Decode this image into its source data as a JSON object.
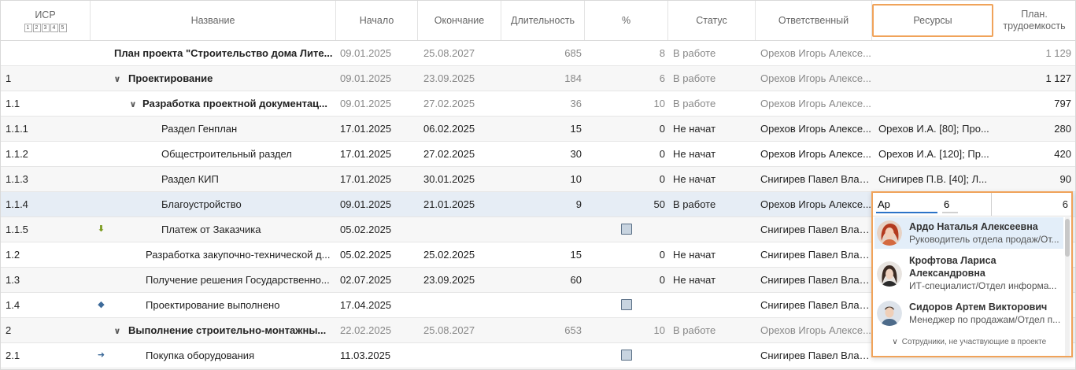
{
  "header": {
    "wbs": "ИСР",
    "levels": [
      "1",
      "2",
      "3",
      "4",
      "5"
    ],
    "name": "Название",
    "start": "Начало",
    "end": "Окончание",
    "duration": "Длительность",
    "percent": "%",
    "status": "Статус",
    "owner": "Ответственный",
    "resources": "Ресурсы",
    "labor": "План. трудоемкость"
  },
  "rows": [
    {
      "wbs": "",
      "name": "План проекта \"Строительство дома Лите...",
      "start": "09.01.2025",
      "end": "25.08.2027",
      "duration": "685",
      "percent": "8",
      "status": "В работе",
      "owner": "Орехов Игорь Алексе...",
      "resources": "",
      "labor": "1 129"
    },
    {
      "wbs": "1",
      "name": "Проектирование",
      "start": "09.01.2025",
      "end": "23.09.2025",
      "duration": "184",
      "percent": "6",
      "status": "В работе",
      "owner": "Орехов Игорь Алексе...",
      "resources": "",
      "labor": "1 127"
    },
    {
      "wbs": "1.1",
      "name": "Разработка проектной документац...",
      "start": "09.01.2025",
      "end": "27.02.2025",
      "duration": "36",
      "percent": "10",
      "status": "В работе",
      "owner": "Орехов Игорь Алексе...",
      "resources": "",
      "labor": "797"
    },
    {
      "wbs": "1.1.1",
      "name": "Раздел Генплан",
      "start": "17.01.2025",
      "end": "06.02.2025",
      "duration": "15",
      "percent": "0",
      "status": "Не начат",
      "owner": "Орехов Игорь Алексе...",
      "resources": "Орехов И.А. [80]; Про...",
      "labor": "280"
    },
    {
      "wbs": "1.1.2",
      "name": "Общестроительный раздел",
      "start": "17.01.2025",
      "end": "27.02.2025",
      "duration": "30",
      "percent": "0",
      "status": "Не начат",
      "owner": "Орехов Игорь Алексе...",
      "resources": "Орехов И.А. [120]; Пр...",
      "labor": "420"
    },
    {
      "wbs": "1.1.3",
      "name": "Раздел КИП",
      "start": "17.01.2025",
      "end": "30.01.2025",
      "duration": "10",
      "percent": "0",
      "status": "Не начат",
      "owner": "Снигирев Павел Влад...",
      "resources": "Снигирев П.В. [40]; Л...",
      "labor": "90"
    },
    {
      "wbs": "1.1.4",
      "name": "Благоустройство",
      "start": "09.01.2025",
      "end": "21.01.2025",
      "duration": "9",
      "percent": "50",
      "status": "В работе",
      "owner": "Орехов Игорь Алексе...",
      "resources": "",
      "labor": "6"
    },
    {
      "wbs": "1.1.5",
      "name": "Платеж от Заказчика",
      "start": "05.02.2025",
      "end": "",
      "duration": "",
      "percent": "",
      "status": "",
      "owner": "Снигирев Павел Влад...",
      "resources": "",
      "labor": ""
    },
    {
      "wbs": "1.2",
      "name": "Разработка закупочно-технической д...",
      "start": "05.02.2025",
      "end": "25.02.2025",
      "duration": "15",
      "percent": "0",
      "status": "Не начат",
      "owner": "Снигирев Павел Влад...",
      "resources": "",
      "labor": ""
    },
    {
      "wbs": "1.3",
      "name": "Получение решения Государственно...",
      "start": "02.07.2025",
      "end": "23.09.2025",
      "duration": "60",
      "percent": "0",
      "status": "Не начат",
      "owner": "Снигирев Павел Влад...",
      "resources": "",
      "labor": ""
    },
    {
      "wbs": "1.4",
      "name": "Проектирование выполнено",
      "start": "17.04.2025",
      "end": "",
      "duration": "",
      "percent": "",
      "status": "",
      "owner": "Снигирев Павел Влад...",
      "resources": "",
      "labor": ""
    },
    {
      "wbs": "2",
      "name": "Выполнение строительно-монтажны...",
      "start": "22.02.2025",
      "end": "25.08.2027",
      "duration": "653",
      "percent": "10",
      "status": "В работе",
      "owner": "Орехов Игорь Алексе...",
      "resources": "",
      "labor": ""
    },
    {
      "wbs": "2.1",
      "name": "Покупка оборудования",
      "start": "11.03.2025",
      "end": "",
      "duration": "",
      "percent": "",
      "status": "",
      "owner": "Снигирев Павел Влад...",
      "resources": "",
      "labor": ""
    }
  ],
  "icons": {
    "expand": "chevron-down-icon",
    "payment": "arrow-down-icon",
    "milestone": "diamond-icon",
    "purchase": "arrow-right-icon"
  },
  "editor": {
    "search_value": "Ар",
    "qty_value": "6",
    "options": [
      {
        "name": "Ардо Наталья Алексеевна",
        "role": "Руководитель отдела продаж/От..."
      },
      {
        "name": "Крофтова Лариса Александровна",
        "role": "ИТ-специалист/Отдел информа..."
      },
      {
        "name": "Сидоров Артем Викторович",
        "role": "Менеджер по продажам/Отдел п..."
      }
    ],
    "more_label": "Сотрудники, не участвующие в проекте"
  },
  "colors": {
    "highlight": "#f0a35a",
    "selected_row": "#e6edf5",
    "accent": "#2b73c7"
  }
}
